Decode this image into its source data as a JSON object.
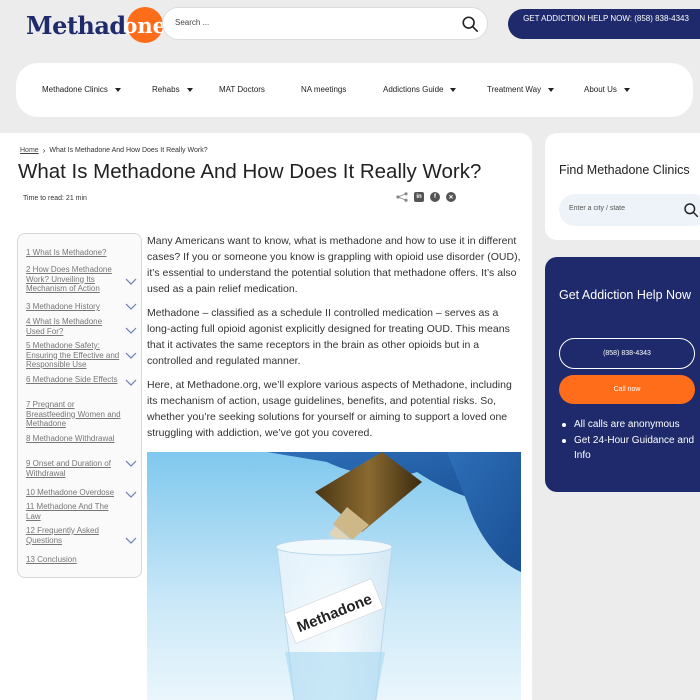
{
  "header": {
    "logo_text": "Methad",
    "logo_circle_text": "one",
    "search_placeholder": "Search ...",
    "help_button_label": "GET ADDICTION HELP NOW: (858) 838-4343"
  },
  "nav": {
    "items": [
      {
        "label": "Methadone Clinics",
        "has_dropdown": true
      },
      {
        "label": "Rehabs",
        "has_dropdown": true
      },
      {
        "label": "MAT Doctors",
        "has_dropdown": false
      },
      {
        "label": "NA meetings",
        "has_dropdown": false
      },
      {
        "label": "Addictions Guide",
        "has_dropdown": true
      },
      {
        "label": "Treatment Way",
        "has_dropdown": true
      },
      {
        "label": "About Us",
        "has_dropdown": true
      }
    ]
  },
  "breadcrumb": {
    "home": "Home",
    "current": "What Is Methadone And How Does It Really Work?"
  },
  "article": {
    "title": "What Is Methadone And How Does It Really Work?",
    "read_time": "Time to read: 21 min",
    "paragraphs": [
      "Many Americans want to know, what is methadone and how to use it in different cases? If you or someone you know is grappling with opioid use disorder (OUD), it’s essential to understand the potential solution that methadone offers. It’s also used as a pain relief medication.",
      "Methadone – classified as a schedule II controlled medication – serves as a long-acting full opioid agonist explicitly designed for treating OUD. This means that it activates the same receptors in the brain as other opioids but in a controlled and regulated manner.",
      "Here, at Methadone.org, we’ll explore various aspects of Methadone, including its mechanism of action, usage guidelines, benefits, and potential risks. So, whether you’re seeking solutions for yourself or aiming to support a loved one struggling with addiction, we’ve got you covered."
    ],
    "image_label": "Methadone"
  },
  "share_icons": [
    "share-icon",
    "linkedin-icon",
    "facebook-icon",
    "x-icon"
  ],
  "toc": {
    "items": [
      {
        "label": "1 What Is Methadone?",
        "expandable": false
      },
      {
        "label": "2 How Does Methadone Work? Unveiling Its Mechanism of Action",
        "expandable": true
      },
      {
        "label": "3 Methadone History",
        "expandable": true
      },
      {
        "label": "4 What Is Methadone Used For?",
        "expandable": true
      },
      {
        "label": "5 Methadone Safety: Ensuring the Effective and Responsible Use",
        "expandable": true
      },
      {
        "label": "6 Methadone Side Effects",
        "expandable": true
      },
      {
        "label": "7 Pregnant or Breastfeeding Women and Methadone",
        "expandable": false
      },
      {
        "label": "8 Methadone Withdrawal",
        "expandable": false
      },
      {
        "label": "9 Onset and Duration of Withdrawal",
        "expandable": true
      },
      {
        "label": "10 Methadone Overdose",
        "expandable": true
      },
      {
        "label": "11 Methadone And The Law",
        "expandable": false
      },
      {
        "label": "12 Frequently Asked Questions",
        "expandable": true
      },
      {
        "label": "13 Conclusion",
        "expandable": false
      }
    ]
  },
  "sidebar": {
    "find_title": "Find Methadone Clinics",
    "city_placeholder": "Enter a city / state",
    "help_title": "Get Addiction Help Now",
    "phone_label": "(858) 838-4343",
    "call_label": "Call now",
    "bullets": [
      "All calls are anonymous",
      "Get 24-Hour Guidance and Info"
    ]
  },
  "colors": {
    "brand_navy": "#1e2a6b",
    "brand_orange": "#ff6c1a",
    "page_bg": "#ececec"
  }
}
